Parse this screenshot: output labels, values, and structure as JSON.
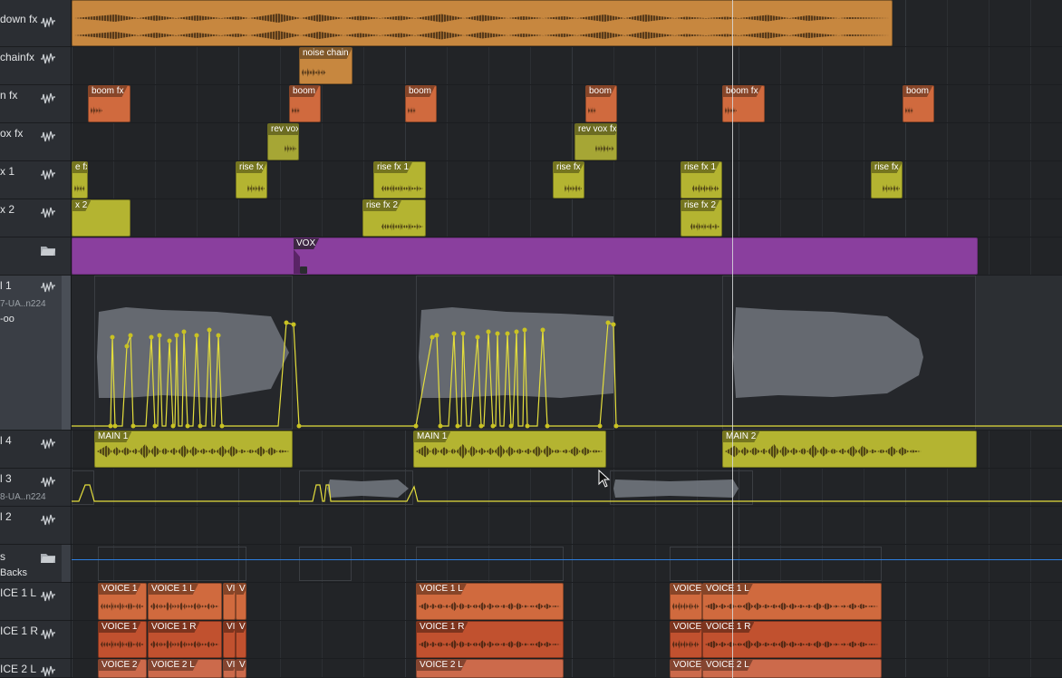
{
  "tracks": [
    {
      "id": "t0",
      "name": "down fx",
      "type": "audio"
    },
    {
      "id": "t1",
      "name": "chainfx",
      "type": "audio"
    },
    {
      "id": "t2",
      "name": "n fx",
      "type": "audio"
    },
    {
      "id": "t3",
      "name": "ox fx",
      "type": "audio"
    },
    {
      "id": "t4",
      "name": "x 1",
      "type": "audio"
    },
    {
      "id": "t5",
      "name": "x 2",
      "type": "audio"
    },
    {
      "id": "t6",
      "name": "",
      "type": "folder"
    },
    {
      "id": "t7",
      "name": "l 1",
      "sub1": "7-UA..n224",
      "sub2": "-oo",
      "type": "audio"
    },
    {
      "id": "t8",
      "name": "l 4",
      "type": "audio"
    },
    {
      "id": "t9",
      "name": "l 3",
      "sub1": "8-UA..n224",
      "type": "audio"
    },
    {
      "id": "t10",
      "name": "l 2",
      "type": "audio"
    },
    {
      "id": "t11",
      "name": "s",
      "sub1": "Backs",
      "type": "folder"
    },
    {
      "id": "t12",
      "name": "ICE 1 L",
      "type": "audio"
    },
    {
      "id": "t13",
      "name": "ICE 1 R",
      "type": "audio"
    },
    {
      "id": "t14",
      "name": "ICE 2 L",
      "type": "audio"
    }
  ],
  "clips": {
    "noise": "noise chain",
    "boom_fx": "boom fx",
    "boom": "boom",
    "rev_vox": "rev vox",
    "rev_vox_fx": "rev vox fx",
    "e_fx": "e fx",
    "rise_fx": "rise fx",
    "rise_fx_1": "rise fx 1",
    "rise_fx_1_short": "rise fx 1",
    "x2": "x 2",
    "rise_fx_2": "rise fx 2",
    "rise_fx_2_short": "rise fx 2",
    "vox": "VOX",
    "main1": "MAIN 1",
    "main2": "MAIN 2",
    "voice1": "VOICE 1",
    "voice1l": "VOICE 1 L",
    "voice1r": "VOICE 1 R",
    "voice2": "VOICE 2",
    "voice2l": "VOICE 2 L",
    "vi": "VI",
    "v": "V",
    "voice": "VOICE"
  },
  "colors": {
    "orange": "#c7873f",
    "orange_red": "#d06a3e",
    "red": "#c1512f",
    "yellow_green": "#b4b431",
    "olive": "#a6a635",
    "purple": "#8a3f9e",
    "selected_track": "#3a3e45",
    "automation": "#e4de3c",
    "marker_blue": "#2d7fe0"
  },
  "icons": {
    "waveform": "waveform-icon",
    "folder": "folder-icon",
    "cursor": "mouse-pointer-icon"
  }
}
